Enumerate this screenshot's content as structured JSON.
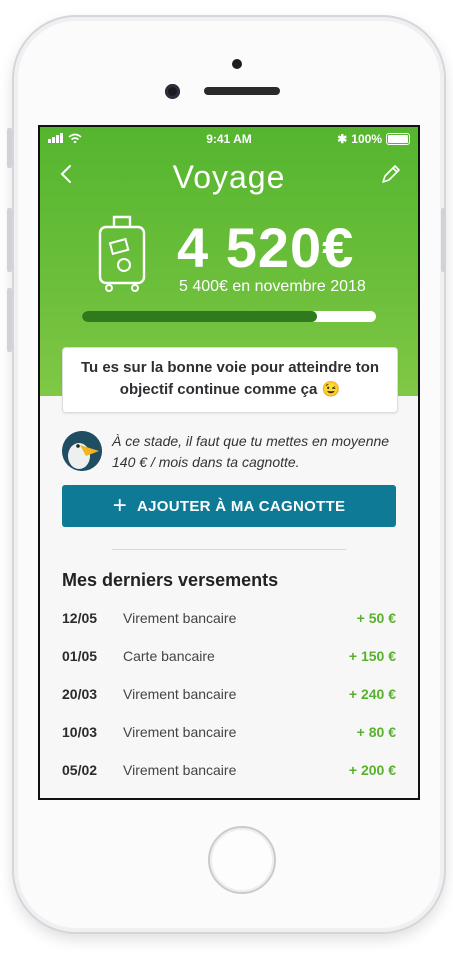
{
  "status_bar": {
    "time": "9:41 AM",
    "battery": "100%"
  },
  "header": {
    "title": "Voyage",
    "amount": "4 520€",
    "goal": "5 400€ en novembre 2018",
    "progress": 0.8
  },
  "message_card": {
    "text": "Tu es sur la bonne voie pour atteindre ton objectif continue comme ça 😉"
  },
  "advice": {
    "text": "À ce stade, il faut que tu mettes en moyenne 140 € / mois dans ta cagnotte."
  },
  "cta": {
    "label": "AJOUTER À MA CAGNOTTE"
  },
  "section": {
    "title": "Mes derniers versements"
  },
  "payments": [
    {
      "date": "12/05",
      "label": "Virement bancaire",
      "amount": "+ 50 €"
    },
    {
      "date": "01/05",
      "label": "Carte bancaire",
      "amount": "+ 150 €"
    },
    {
      "date": "20/03",
      "label": "Virement bancaire",
      "amount": "+ 240 €"
    },
    {
      "date": "10/03",
      "label": "Virement bancaire",
      "amount": "+ 80 €"
    },
    {
      "date": "05/02",
      "label": "Virement bancaire",
      "amount": "+ 200 €"
    }
  ],
  "icons": {
    "back": "chevron-left-icon",
    "edit": "pencil-icon",
    "suitcase": "suitcase-icon",
    "avatar": "pelican-avatar-icon",
    "plus": "plus-icon"
  },
  "colors": {
    "header_green": "#55b52f",
    "progress_fill": "#2f7a1d",
    "cta_blue": "#0f7a96",
    "amount_green": "#58b12c"
  }
}
